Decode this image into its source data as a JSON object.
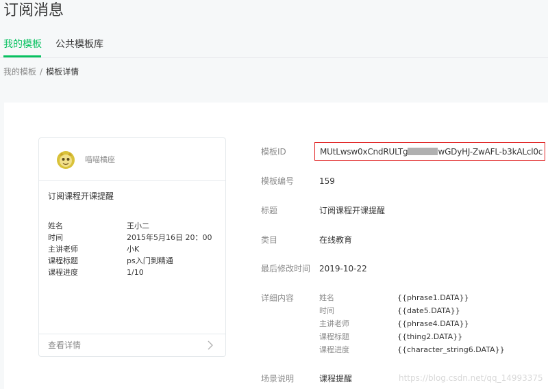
{
  "page": {
    "title": "订阅消息"
  },
  "tabs": [
    {
      "label": "我的模板",
      "active": true
    },
    {
      "label": "公共模板库",
      "active": false
    }
  ],
  "breadcrumb": {
    "parent": "我的模板",
    "separator": "/",
    "current": "模板详情"
  },
  "preview_card": {
    "account_name": "喵喵橘座",
    "message_title": "订阅课程开课提醒",
    "fields": [
      {
        "label": "姓名",
        "value": "王小二"
      },
      {
        "label": "时间",
        "value": "2015年5月16日 20：00"
      },
      {
        "label": "主讲老师",
        "value": "小K"
      },
      {
        "label": "课程标题",
        "value": "ps入门到精通"
      },
      {
        "label": "课程进度",
        "value": "1/10"
      }
    ],
    "footer_label": "查看详情"
  },
  "details": {
    "template_id_label": "模板ID",
    "template_id_prefix": "MUtLwsw0xCndRULTg",
    "template_id_suffix": "wGDyHJ-ZwAFL-b3kALcl0c",
    "template_no_label": "模板编号",
    "template_no": "159",
    "title_label": "标题",
    "title": "订阅课程开课提醒",
    "category_label": "类目",
    "category": "在线教育",
    "modified_label": "最后修改时间",
    "modified": "2019-10-22",
    "content_label": "详细内容",
    "content": [
      {
        "label": "姓名",
        "value": "{{phrase1.DATA}}"
      },
      {
        "label": "时间",
        "value": "{{date5.DATA}}"
      },
      {
        "label": "主讲老师",
        "value": "{{phrase4.DATA}}"
      },
      {
        "label": "课程标题",
        "value": "{{thing2.DATA}}"
      },
      {
        "label": "课程进度",
        "value": "{{character_string6.DATA}}"
      }
    ],
    "scene_label": "场景说明",
    "scene": "课程提醒"
  },
  "watermark": "https://blog.csdn.net/qq_14993375",
  "colors": {
    "accent": "#07c160",
    "highlight_border": "#e02020"
  }
}
